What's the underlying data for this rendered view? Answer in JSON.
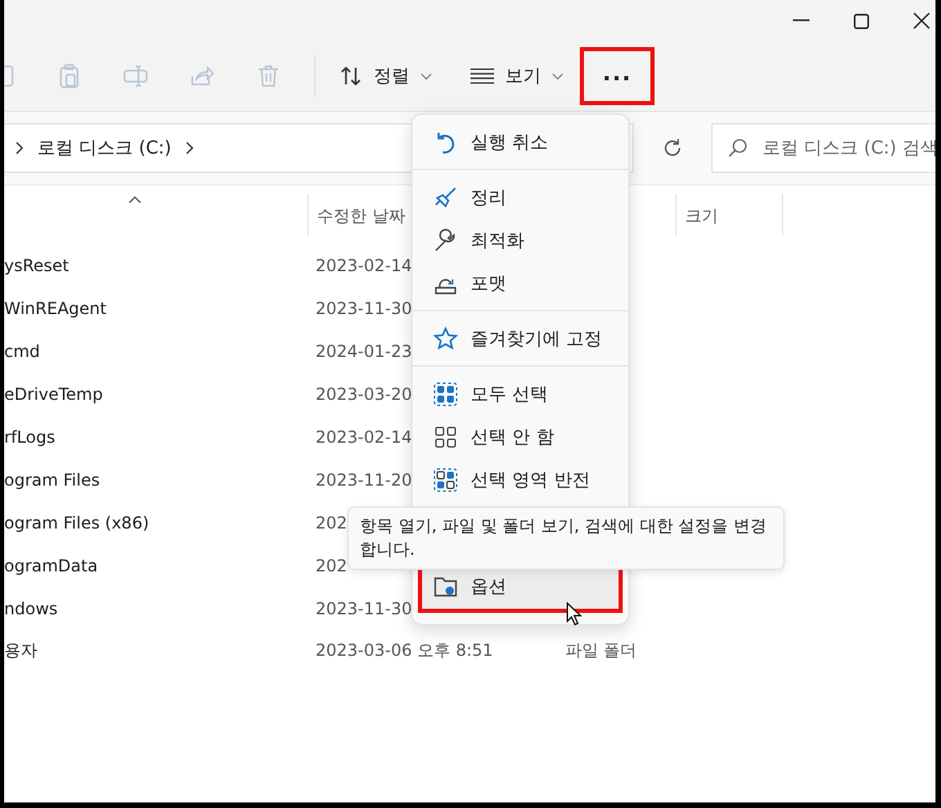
{
  "toolbar": {
    "icon_buttons": [
      {
        "disabled": true
      },
      {
        "disabled": true
      },
      {
        "disabled": true
      },
      {
        "disabled": true
      },
      {
        "disabled": true
      }
    ],
    "sort_button": {
      "label": "정렬"
    },
    "view_button": {
      "label": "보기"
    },
    "more_button": {
      "label": "...",
      "callout": true
    }
  },
  "address_bar": {
    "path": [
      "로컬 디스크 (C:)"
    ]
  },
  "search": {
    "placeholder": "로컬 디스크 (C:) 검색"
  },
  "header": {
    "date": "수정한 날짜",
    "size": "크기"
  },
  "rows": [
    {
      "name": "ysReset",
      "date": "2023-02-14"
    },
    {
      "name": "WinREAgent",
      "date": "2023-11-30"
    },
    {
      "name": "cmd",
      "date": "2024-01-23"
    },
    {
      "name": "eDriveTemp",
      "date": "2023-03-20"
    },
    {
      "name": "rfLogs",
      "date": "2023-02-14"
    },
    {
      "name": "ogram Files",
      "date": "2023-11-20"
    },
    {
      "name": "ogram Files (x86)",
      "date": "202"
    },
    {
      "name": "ogramData",
      "date": "202"
    },
    {
      "name": "ndows",
      "date": "2023-11-30"
    },
    {
      "name": "용자",
      "date": "2023-03-06 오후 8:51",
      "type": "파일 폴더"
    }
  ],
  "menu": {
    "groups": [
      [
        {
          "label": "실행 취소",
          "highlighted": false,
          "callout": false
        }
      ],
      [
        {
          "label": "정리",
          "highlighted": false,
          "callout": false
        },
        {
          "label": "최적화",
          "highlighted": false,
          "callout": false
        },
        {
          "label": "포맷",
          "highlighted": false,
          "callout": false
        }
      ],
      [
        {
          "label": "즐겨찾기에 고정",
          "highlighted": false,
          "callout": false
        }
      ],
      [
        {
          "label": "모두 선택",
          "highlighted": false,
          "callout": false
        },
        {
          "label": "선택 안 함",
          "highlighted": false,
          "callout": false
        },
        {
          "label": "선택 영역 반전",
          "highlighted": false,
          "callout": false
        }
      ],
      [
        {
          "label": "옵션",
          "highlighted": true,
          "callout": true
        }
      ]
    ]
  },
  "tooltip": {
    "text": "항목 열기, 파일 및 폴더 보기, 검색에 대한 설정을 변경합니다."
  }
}
